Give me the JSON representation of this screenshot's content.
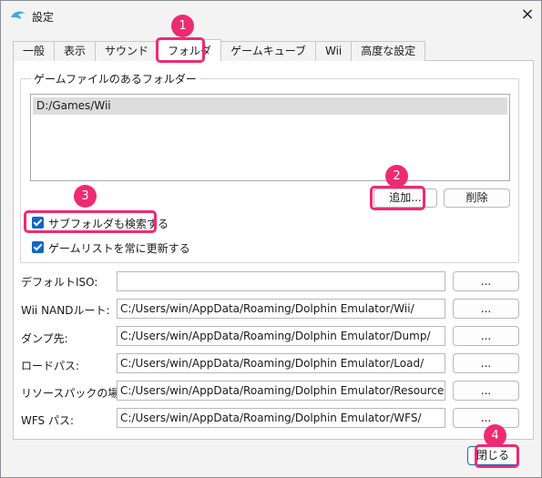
{
  "window": {
    "title": "設定"
  },
  "tabs": [
    "一般",
    "表示",
    "サウンド",
    "フォルダ",
    "ゲームキューブ",
    "Wii",
    "高度な設定"
  ],
  "folders": {
    "group_title": "ゲームファイルのあるフォルダー",
    "items": [
      "D:/Games/Wii"
    ],
    "add_label": "追加...",
    "remove_label": "削除"
  },
  "options": {
    "search_subfolders": "サブフォルダも検索する",
    "always_refresh": "ゲームリストを常に更新する"
  },
  "paths": [
    {
      "label": "デフォルトISO:",
      "value": ""
    },
    {
      "label": "Wii NANDルート:",
      "value": "C:/Users/win/AppData/Roaming/Dolphin Emulator/Wii/"
    },
    {
      "label": "ダンプ先:",
      "value": "C:/Users/win/AppData/Roaming/Dolphin Emulator/Dump/"
    },
    {
      "label": "ロードパス:",
      "value": "C:/Users/win/AppData/Roaming/Dolphin Emulator/Load/"
    },
    {
      "label": "リソースパックの場所:",
      "value": "C:/Users/win/AppData/Roaming/Dolphin Emulator/ResourcePacks/"
    },
    {
      "label": "WFS パス:",
      "value": "C:/Users/win/AppData/Roaming/Dolphin Emulator/WFS/"
    }
  ],
  "browse_label": "...",
  "close_label": "閉じる",
  "annotations": [
    "1",
    "2",
    "3",
    "4"
  ],
  "colors": {
    "highlight": "#ee2a72",
    "checkbox": "#0f67c6"
  }
}
